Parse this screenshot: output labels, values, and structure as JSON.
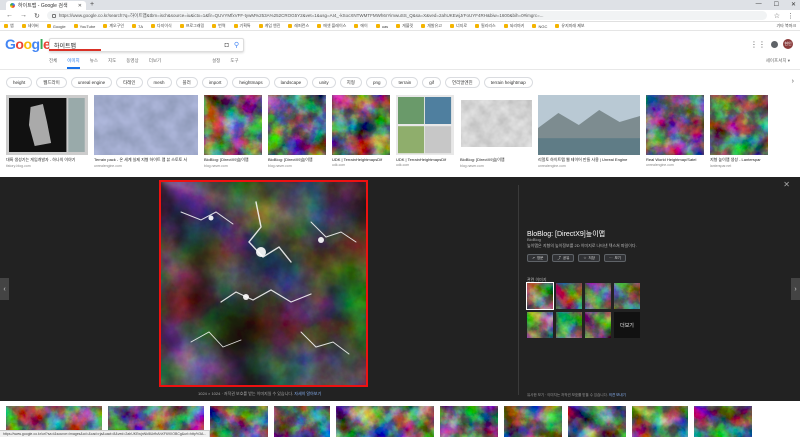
{
  "browser": {
    "tab_title": "하이트맵 - Google 검색",
    "url": "https://www.google.co.kr/search?q=하이트맵&tbm=isch&source=iu&ictx=1&fir=QUVYMfxVFF-tywM%253A%252CROG5Y2&vet=1&usg=AI4_-kSocXNTWMTFMWh6rYimwuSS_Q&sa=X&ved=2ahUKEwjJrFoUYF4RH&biw=1600&bih=0#imgrc=..."
  },
  "bookmarks": [
    "앱",
    "네이버",
    "Google",
    "YouTube",
    "계오구인",
    "7A",
    "다지이식",
    "프로그래밍",
    "번역",
    "기획특",
    "게임 엔진",
    "레퍼런스",
    "애셋 플레이스",
    "에이",
    "uas",
    "게블릿",
    "개발유고",
    "너지로",
    "필리리스",
    "되리마키",
    "NGC",
    "유지미래 제보"
  ],
  "bookmarks_right": "기타 북마크",
  "search": {
    "logo": [
      "G",
      "o",
      "o",
      "g",
      "l",
      "e"
    ],
    "query": "하이트맵"
  },
  "header": {
    "avatar": "현인"
  },
  "tabs": [
    "전체",
    "이미지",
    "뉴스",
    "지도",
    "동영상",
    "더보기"
  ],
  "tools": [
    "설정",
    "도구"
  ],
  "safesearch": "세이프서치 ▾",
  "chips": [
    "height",
    "웹드라이",
    "unreal engine",
    "타레인",
    "mesh",
    "블러",
    "import",
    "heightmaps",
    "landscape",
    "unity",
    "지형",
    "png",
    "terrain",
    "gif",
    "언리얼엔진",
    "terrain heightmap"
  ],
  "results": [
    {
      "title": "대륙 생성기는 게임개발자 - 하나의 이야기",
      "site": "tistory-blog.com",
      "w": 82,
      "kind": "ukmap"
    },
    {
      "title": "Terrain pack - 온 세계 실제 지형 하이트 맵 뷰 스토토 서",
      "site": "unrealengine.com",
      "w": 104,
      "kind": "satellite"
    },
    {
      "title": "BloBlog: [DirectX9]높이맵",
      "site": "blog.naver.com",
      "w": 58,
      "kind": "hm1"
    },
    {
      "title": "BloBlog: [DirectX9]높이맵",
      "site": "blog.naver.com",
      "w": 58,
      "kind": "hm2"
    },
    {
      "title": "UDK | TerrainHeightmapsDif",
      "site": "udk.com",
      "w": 58,
      "kind": "hm3"
    },
    {
      "title": "UDK | TerrainHeightmapsDif",
      "site": "udk.com",
      "w": 58,
      "kind": "udkui"
    },
    {
      "title": "BloBlog: [DirectX9]높이맵",
      "site": "blog.naver.com",
      "w": 72,
      "kind": "mesh"
    },
    {
      "title": "리얼토 하이트맵 웹 테이어 만들 사용 | Unreal Engine",
      "site": "unrealengine.com",
      "w": 102,
      "kind": "landscape"
    },
    {
      "title": "Real World Heightmap/Satel",
      "site": "unrealengine.com",
      "w": 58,
      "kind": "hm4"
    },
    {
      "title": "지형 높이맵 생성 - Lanterspar",
      "site": "lanterspar.net",
      "w": 58,
      "kind": "hm5"
    }
  ],
  "preview": {
    "caption_prefix": "1024 × 1024 · 저작권 보호를 받는 이미지일 수 있습니다.",
    "caption_link": "자세히 알아보기",
    "title": "BloBlog: [DirectX9]높이맵",
    "site": "BloBlog",
    "description": "높이맵은 지형의 높이정보를 2D 이미지로 나타낸 텍스쳐 파일이다.",
    "buttons": [
      "방문",
      "공유",
      "저장",
      "보기"
    ],
    "related_label": "관련 이미지",
    "related_more": "더보기",
    "footer": "유사한 보기 · 이미지는 저작권 보호를 받을 수 있습니다.",
    "footer_link": "의견 보내기"
  },
  "status_url": "https://www.google.co.kr/url?sa=i&source=images&cd=&cad=rja&uact=8&ved=2ahUKEwjnNkl6UrfbAhXF69XOBCg&url=http%3A..."
}
